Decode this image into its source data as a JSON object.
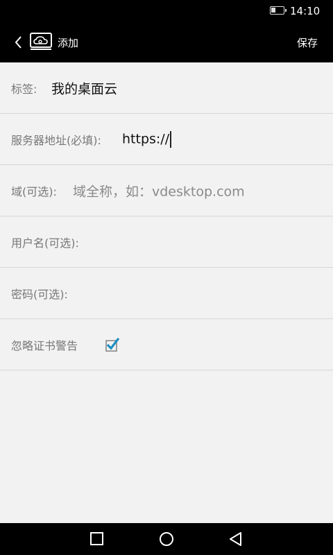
{
  "status_bar": {
    "time": "14:10"
  },
  "app_bar": {
    "title": "添加",
    "save_label": "保存"
  },
  "form": {
    "label_field": {
      "label": "标签:",
      "value": "我的桌面云"
    },
    "server_field": {
      "label": "服务器地址(必填):",
      "value": "https://"
    },
    "domain_field": {
      "label": "域(可选):",
      "placeholder": "域全称，如：vdesktop.com"
    },
    "username_field": {
      "label": "用户名(可选):",
      "value": ""
    },
    "password_field": {
      "label": "密码(可选):",
      "value": ""
    },
    "ignore_cert": {
      "label": "忽略证书警告",
      "checked": true
    }
  },
  "colors": {
    "bar_background": "#000000",
    "page_background": "#f2f2f2",
    "checkbox_accent": "#1c8fc1"
  },
  "icons": [
    "back-icon",
    "cloud-logo-icon",
    "checkbox-checked-icon",
    "recent-apps-icon",
    "home-icon",
    "back-nav-icon"
  ]
}
